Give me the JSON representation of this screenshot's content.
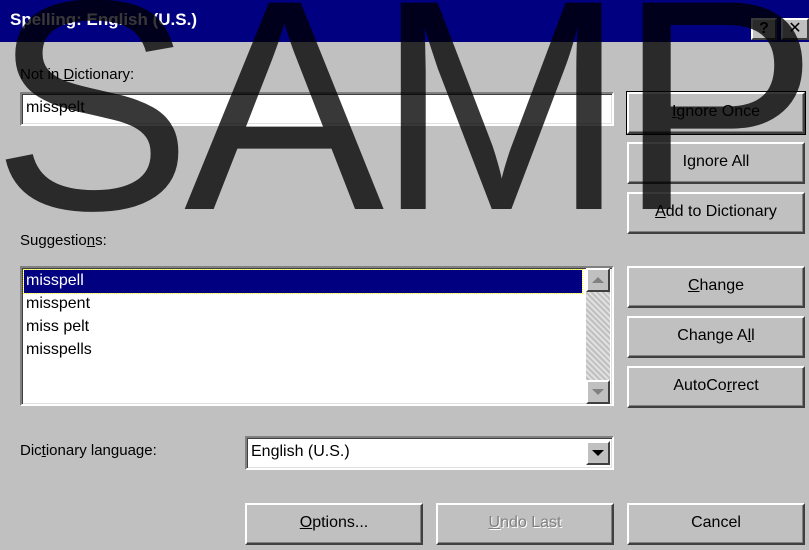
{
  "window": {
    "title": "Spelling: English (U.S.)",
    "help_glyph": "?",
    "close_glyph": "✕"
  },
  "watermark": "SAMP",
  "not_in_dictionary": {
    "label_pre": "Not in ",
    "label_key": "D",
    "label_post": "ictionary:",
    "value": "misspelt"
  },
  "suggestions": {
    "label_pre": "Suggestio",
    "label_key": "n",
    "label_post": "s:",
    "items": [
      "misspell",
      "misspent",
      "miss pelt",
      "misspells"
    ],
    "selected_index": 0
  },
  "language": {
    "label_pre": "Dic",
    "label_key": "t",
    "label_post": "ionary language:",
    "value": "English (U.S.)"
  },
  "buttons": {
    "ignore_once": {
      "pre": "",
      "key": "I",
      "post": "gnore Once"
    },
    "ignore_all": {
      "pre": "I",
      "key": "g",
      "post": "nore All"
    },
    "add_to_dictionary": {
      "pre": "",
      "key": "A",
      "post": "dd to Dictionary"
    },
    "change": {
      "pre": "",
      "key": "C",
      "post": "hange"
    },
    "change_all": {
      "pre": "Change A",
      "key": "l",
      "post": "l"
    },
    "autocorrect": {
      "pre": "AutoCo",
      "key": "r",
      "post": "rect"
    },
    "options": {
      "pre": "",
      "key": "O",
      "post": "ptions..."
    },
    "undo_last": {
      "pre": "",
      "key": "U",
      "post": "ndo Last"
    },
    "cancel": {
      "pre": "",
      "key": "",
      "post": "Cancel"
    }
  },
  "colors": {
    "titlebar": "#000080",
    "face": "#c0c0c0",
    "selection": "#000080"
  }
}
